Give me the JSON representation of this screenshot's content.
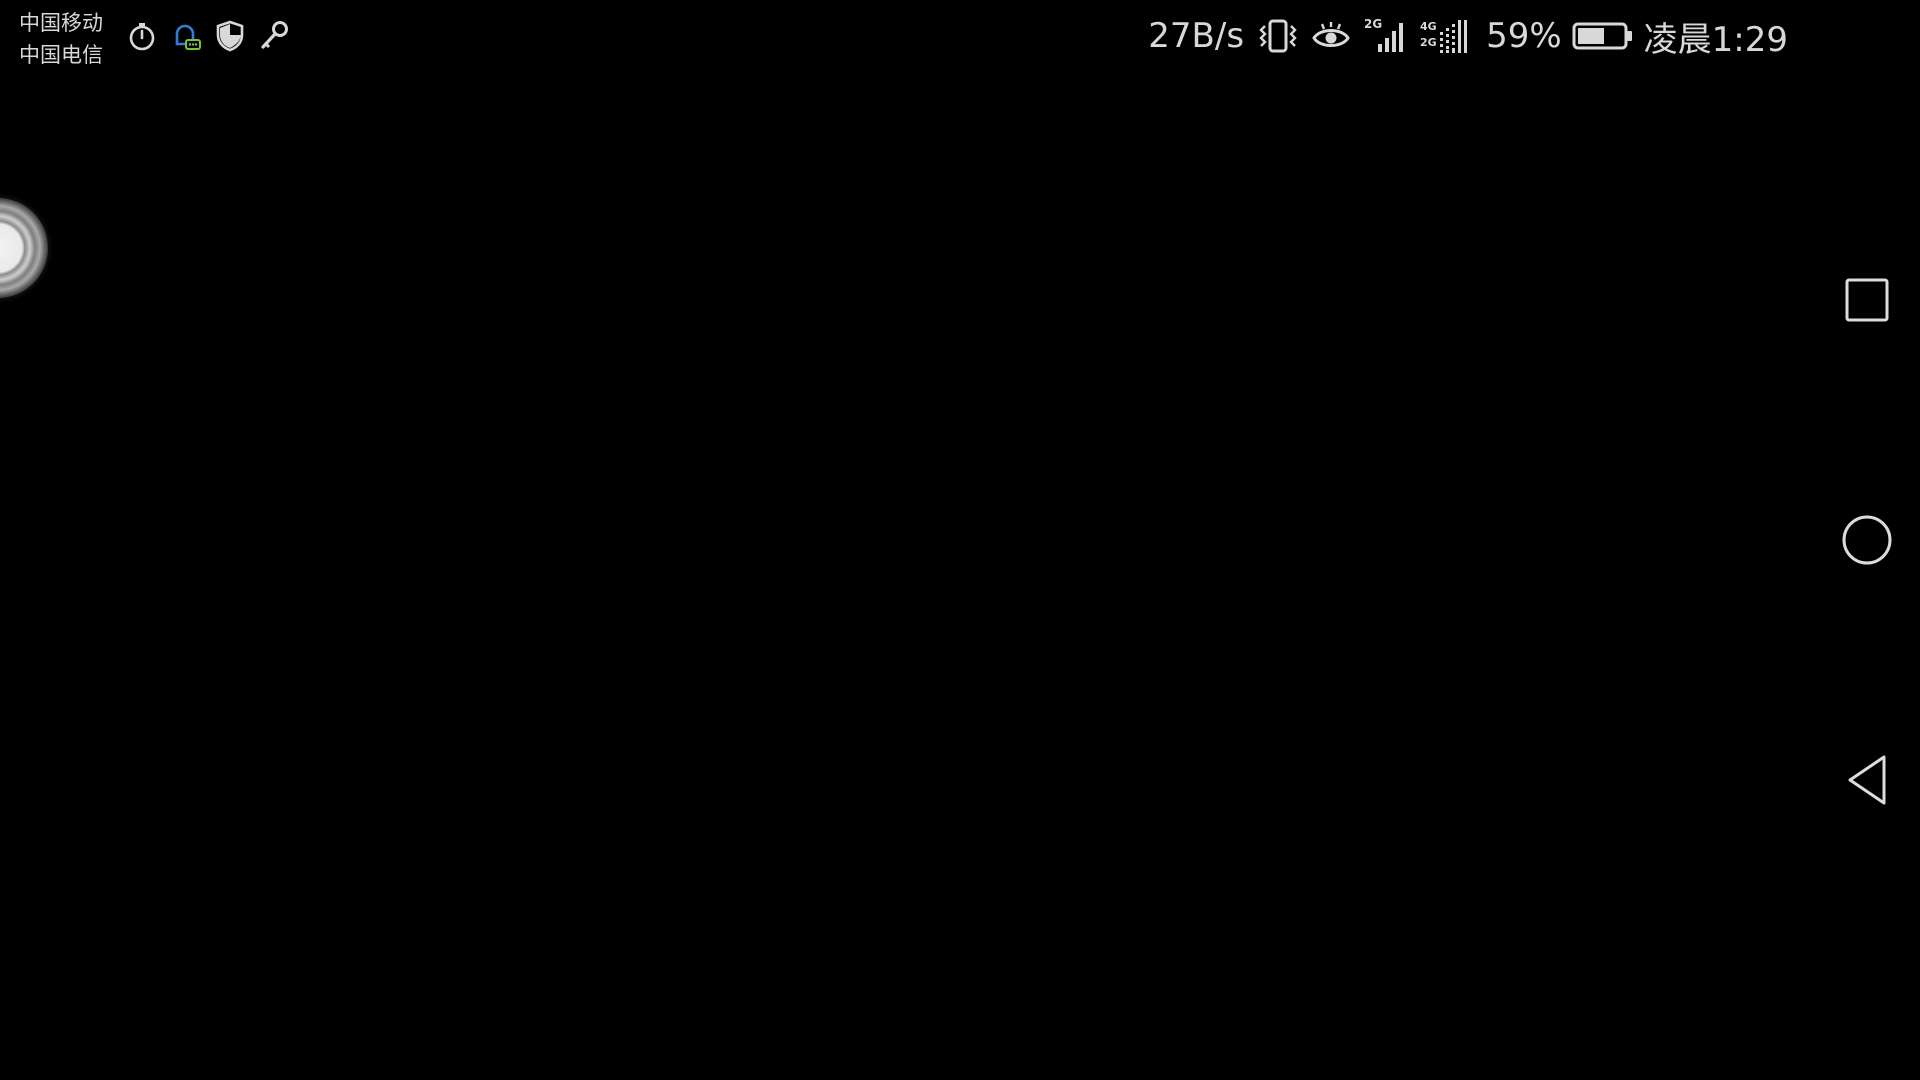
{
  "status_bar": {
    "carriers": [
      "中国移动",
      "中国电信"
    ],
    "left_icons": [
      "timer-icon",
      "chat-bell-icon",
      "shield-icon",
      "key-icon"
    ],
    "network_speed": "27B/s",
    "right_icons": [
      "vibrate-icon",
      "eye-icon",
      "signal-2g-icon",
      "signal-4g-2g-icon",
      "battery-icon"
    ],
    "signal_1_label": "2G",
    "signal_2_label_top": "4G",
    "signal_2_label_bottom": "2G",
    "battery_percent": "59%",
    "battery_level": 0.59,
    "time": "凌晨1:29"
  },
  "floating_ball": {
    "icon": "assistive-ball-icon"
  },
  "nav_bar": {
    "recent_icon": "square-recent-apps-icon",
    "home_icon": "circle-home-icon",
    "back_icon": "triangle-back-icon"
  },
  "colors": {
    "background": "#000000",
    "foreground": "#d8d8d8",
    "notification_accent_blue": "#2f7ed8",
    "notification_accent_green": "#7bbf3a"
  }
}
